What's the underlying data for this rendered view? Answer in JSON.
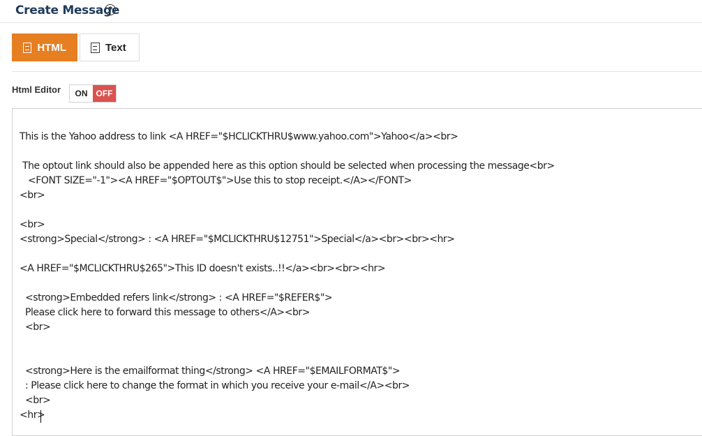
{
  "header": {
    "title": "Create Message",
    "help_icon": "question-circle-icon",
    "help_glyph": "?"
  },
  "tabs": [
    {
      "label": "HTML",
      "icon": "html-file-icon",
      "active": true
    },
    {
      "label": "Text",
      "icon": "text-file-icon",
      "active": false
    }
  ],
  "editor": {
    "label": "Html Editor",
    "toggle_on": "ON",
    "toggle_off": "OFF",
    "state": "OFF"
  },
  "colors": {
    "accent": "#e67e22",
    "off": "#d9534f",
    "title": "#1f3b5c"
  },
  "content": {
    "lines": [
      "This is the Yahoo address to link <A HREF=\"$HCLICKTHRU$www.yahoo.com\">Yahoo</a><br>",
      " The optout link should also be appended here as this option should be selected when processing the message<br>",
      "   <FONT SIZE=\"-1\"><A HREF=\"$OPTOUT$\">Use this to stop receipt.</A></FONT>",
      "<br>",
      "<br>",
      "<strong>Special</strong> : <A HREF=\"$MCLICKTHRU$12751\">Special</a><br><br><hr>",
      "<A HREF=\"$MCLICKTHRU$265\">This ID doesn't exists..!!</a><br><br><hr>",
      "  <strong>Embedded refers link</strong> : <A HREF=\"$REFER$\">",
      "  Please click here to forward this message to others</A><br>",
      "  <br>",
      "  <strong>Here is the emailformat thing</strong> <A HREF=\"$EMAILFORMAT$\">",
      "  : Please click here to change the format in which you receive your e-mail</A><br>",
      "  <br>",
      "<hr>"
    ]
  }
}
